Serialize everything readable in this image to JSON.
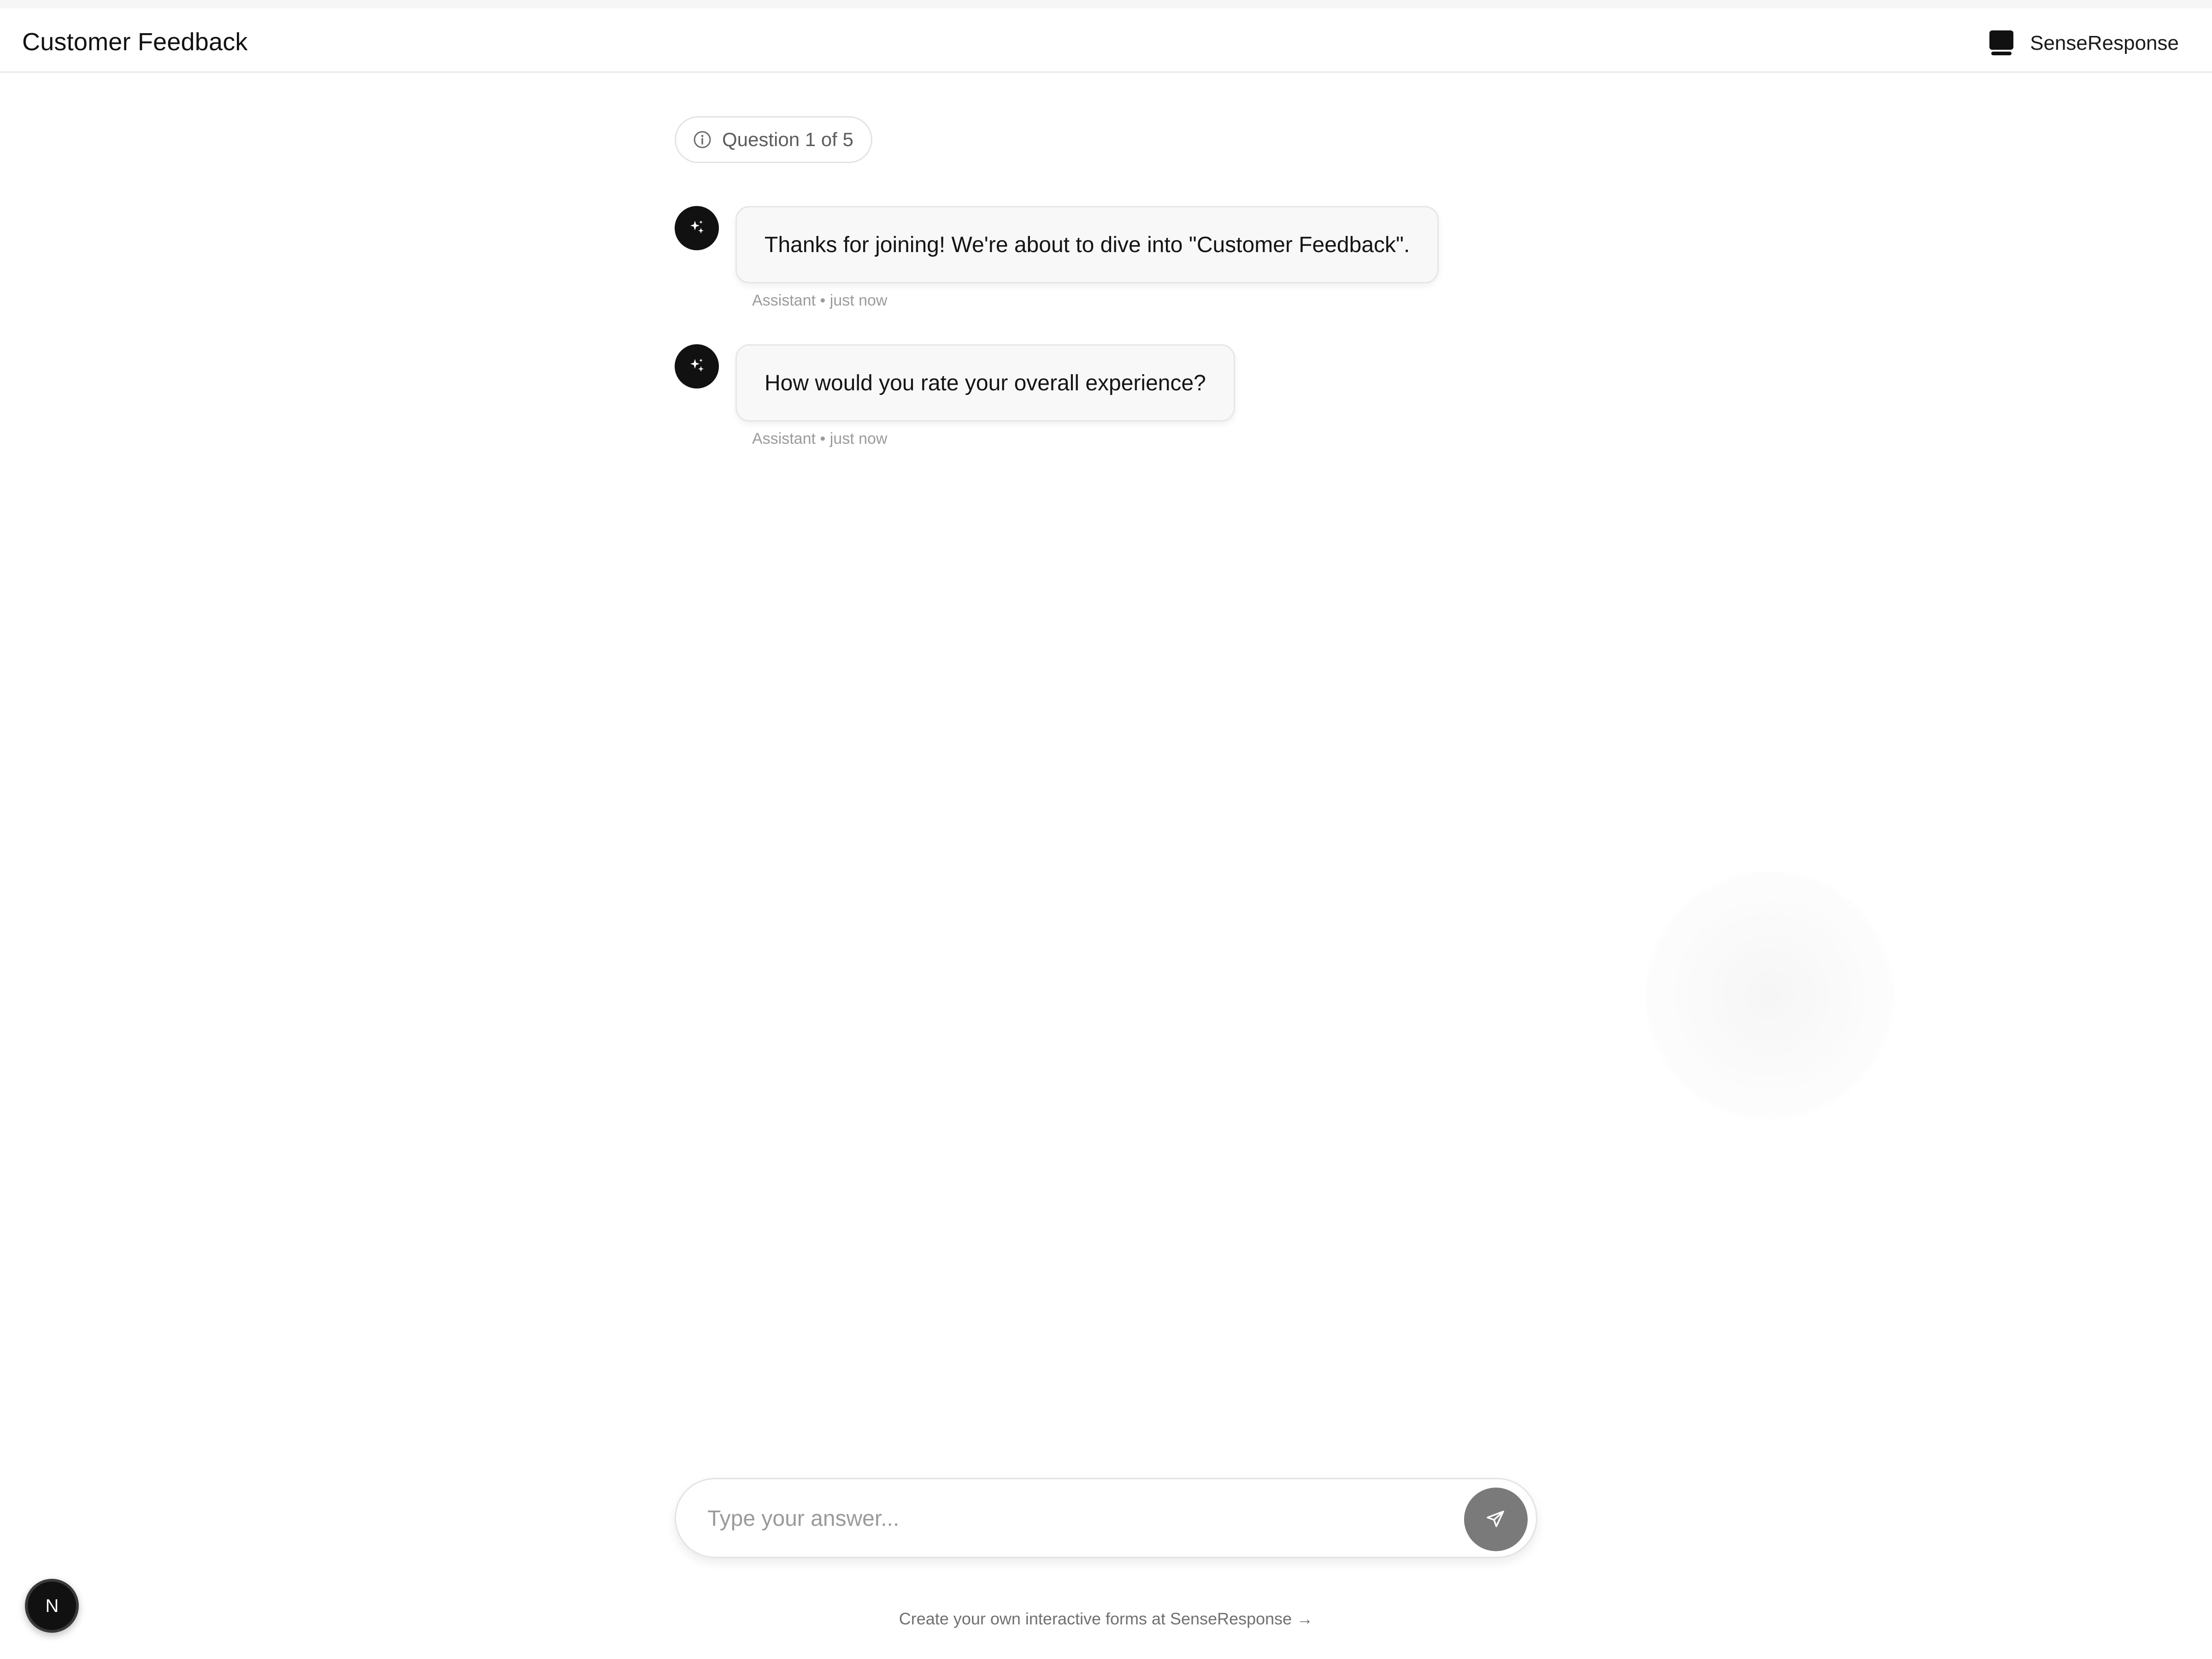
{
  "header": {
    "title": "Customer Feedback",
    "brand_name": "SenseResponse",
    "brand_icon": "monitor-icon"
  },
  "progress": {
    "label": "Question 1 of 5",
    "current": 1,
    "total": 5,
    "icon": "info-icon"
  },
  "messages": [
    {
      "text": "Thanks for joining! We're about to dive into \"Customer Feedback\".",
      "meta": "Assistant • just now",
      "avatar_icon": "sparkle-icon"
    },
    {
      "text": "How would you rate your overall experience?",
      "meta": "Assistant • just now",
      "avatar_icon": "sparkle-icon"
    }
  ],
  "composer": {
    "placeholder": "Type your answer...",
    "value": "",
    "send_icon": "send-icon"
  },
  "footer": {
    "link_text": "Create your own interactive forms at SenseResponse",
    "arrow": "→"
  },
  "dev_badge": {
    "letter": "N"
  },
  "colors": {
    "avatar_bg": "#111111",
    "bubble_bg": "#f8f8f8",
    "send_button_bg": "#7a7a7a",
    "meta_text": "#9b9b9b"
  }
}
